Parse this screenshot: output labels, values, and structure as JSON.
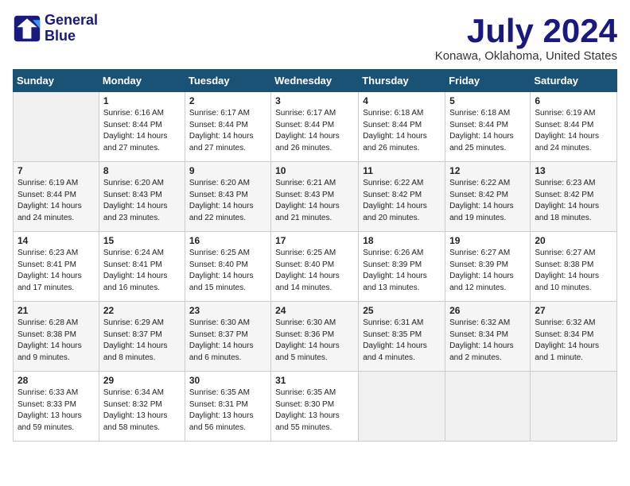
{
  "logo": {
    "line1": "General",
    "line2": "Blue"
  },
  "title": "July 2024",
  "location": "Konawa, Oklahoma, United States",
  "days_header": [
    "Sunday",
    "Monday",
    "Tuesday",
    "Wednesday",
    "Thursday",
    "Friday",
    "Saturday"
  ],
  "weeks": [
    [
      {
        "num": "",
        "info": ""
      },
      {
        "num": "1",
        "info": "Sunrise: 6:16 AM\nSunset: 8:44 PM\nDaylight: 14 hours\nand 27 minutes."
      },
      {
        "num": "2",
        "info": "Sunrise: 6:17 AM\nSunset: 8:44 PM\nDaylight: 14 hours\nand 27 minutes."
      },
      {
        "num": "3",
        "info": "Sunrise: 6:17 AM\nSunset: 8:44 PM\nDaylight: 14 hours\nand 26 minutes."
      },
      {
        "num": "4",
        "info": "Sunrise: 6:18 AM\nSunset: 8:44 PM\nDaylight: 14 hours\nand 26 minutes."
      },
      {
        "num": "5",
        "info": "Sunrise: 6:18 AM\nSunset: 8:44 PM\nDaylight: 14 hours\nand 25 minutes."
      },
      {
        "num": "6",
        "info": "Sunrise: 6:19 AM\nSunset: 8:44 PM\nDaylight: 14 hours\nand 24 minutes."
      }
    ],
    [
      {
        "num": "7",
        "info": "Sunrise: 6:19 AM\nSunset: 8:44 PM\nDaylight: 14 hours\nand 24 minutes."
      },
      {
        "num": "8",
        "info": "Sunrise: 6:20 AM\nSunset: 8:43 PM\nDaylight: 14 hours\nand 23 minutes."
      },
      {
        "num": "9",
        "info": "Sunrise: 6:20 AM\nSunset: 8:43 PM\nDaylight: 14 hours\nand 22 minutes."
      },
      {
        "num": "10",
        "info": "Sunrise: 6:21 AM\nSunset: 8:43 PM\nDaylight: 14 hours\nand 21 minutes."
      },
      {
        "num": "11",
        "info": "Sunrise: 6:22 AM\nSunset: 8:42 PM\nDaylight: 14 hours\nand 20 minutes."
      },
      {
        "num": "12",
        "info": "Sunrise: 6:22 AM\nSunset: 8:42 PM\nDaylight: 14 hours\nand 19 minutes."
      },
      {
        "num": "13",
        "info": "Sunrise: 6:23 AM\nSunset: 8:42 PM\nDaylight: 14 hours\nand 18 minutes."
      }
    ],
    [
      {
        "num": "14",
        "info": "Sunrise: 6:23 AM\nSunset: 8:41 PM\nDaylight: 14 hours\nand 17 minutes."
      },
      {
        "num": "15",
        "info": "Sunrise: 6:24 AM\nSunset: 8:41 PM\nDaylight: 14 hours\nand 16 minutes."
      },
      {
        "num": "16",
        "info": "Sunrise: 6:25 AM\nSunset: 8:40 PM\nDaylight: 14 hours\nand 15 minutes."
      },
      {
        "num": "17",
        "info": "Sunrise: 6:25 AM\nSunset: 8:40 PM\nDaylight: 14 hours\nand 14 minutes."
      },
      {
        "num": "18",
        "info": "Sunrise: 6:26 AM\nSunset: 8:39 PM\nDaylight: 14 hours\nand 13 minutes."
      },
      {
        "num": "19",
        "info": "Sunrise: 6:27 AM\nSunset: 8:39 PM\nDaylight: 14 hours\nand 12 minutes."
      },
      {
        "num": "20",
        "info": "Sunrise: 6:27 AM\nSunset: 8:38 PM\nDaylight: 14 hours\nand 10 minutes."
      }
    ],
    [
      {
        "num": "21",
        "info": "Sunrise: 6:28 AM\nSunset: 8:38 PM\nDaylight: 14 hours\nand 9 minutes."
      },
      {
        "num": "22",
        "info": "Sunrise: 6:29 AM\nSunset: 8:37 PM\nDaylight: 14 hours\nand 8 minutes."
      },
      {
        "num": "23",
        "info": "Sunrise: 6:30 AM\nSunset: 8:37 PM\nDaylight: 14 hours\nand 6 minutes."
      },
      {
        "num": "24",
        "info": "Sunrise: 6:30 AM\nSunset: 8:36 PM\nDaylight: 14 hours\nand 5 minutes."
      },
      {
        "num": "25",
        "info": "Sunrise: 6:31 AM\nSunset: 8:35 PM\nDaylight: 14 hours\nand 4 minutes."
      },
      {
        "num": "26",
        "info": "Sunrise: 6:32 AM\nSunset: 8:34 PM\nDaylight: 14 hours\nand 2 minutes."
      },
      {
        "num": "27",
        "info": "Sunrise: 6:32 AM\nSunset: 8:34 PM\nDaylight: 14 hours\nand 1 minute."
      }
    ],
    [
      {
        "num": "28",
        "info": "Sunrise: 6:33 AM\nSunset: 8:33 PM\nDaylight: 13 hours\nand 59 minutes."
      },
      {
        "num": "29",
        "info": "Sunrise: 6:34 AM\nSunset: 8:32 PM\nDaylight: 13 hours\nand 58 minutes."
      },
      {
        "num": "30",
        "info": "Sunrise: 6:35 AM\nSunset: 8:31 PM\nDaylight: 13 hours\nand 56 minutes."
      },
      {
        "num": "31",
        "info": "Sunrise: 6:35 AM\nSunset: 8:30 PM\nDaylight: 13 hours\nand 55 minutes."
      },
      {
        "num": "",
        "info": ""
      },
      {
        "num": "",
        "info": ""
      },
      {
        "num": "",
        "info": ""
      }
    ]
  ]
}
